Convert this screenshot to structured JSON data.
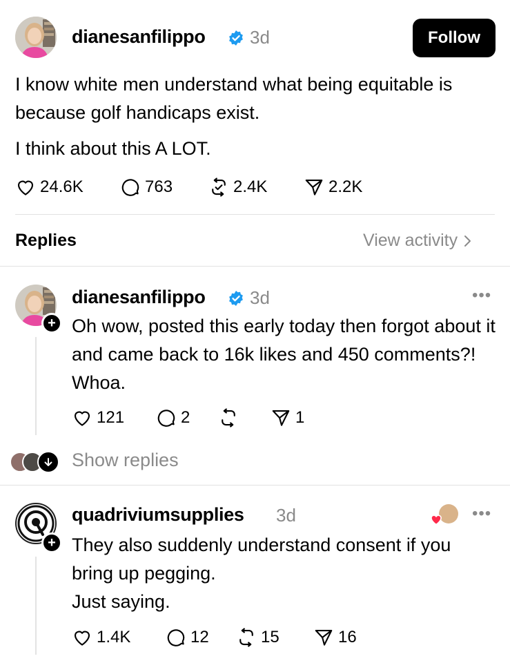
{
  "post": {
    "username": "dianesanfilippo",
    "time": "3d",
    "follow_label": "Follow",
    "paragraph1": "I know white men understand what being equitable is because golf handicaps exist.",
    "paragraph2": "I think about this A LOT.",
    "stats": {
      "likes": "24.6K",
      "comments": "763",
      "reposts": "2.4K",
      "shares": "2.2K"
    }
  },
  "replies_header": {
    "title": "Replies",
    "view_activity": "View activity"
  },
  "reply1": {
    "username": "dianesanfilippo",
    "time": "3d",
    "text": "Oh wow, posted this early today then forgot about it and came back to 16k likes and 450 comments?! Whoa.",
    "stats": {
      "likes": "121",
      "comments": "2",
      "shares": "1"
    },
    "show_replies": "Show replies"
  },
  "reply2": {
    "username": "quadriviumsupplies",
    "time": "3d",
    "line1": "They also suddenly understand consent if you bring up pegging.",
    "line2": "Just saying.",
    "stats": {
      "likes": "1.4K",
      "comments": "12",
      "reposts": "15",
      "shares": "16"
    }
  },
  "colors": {
    "verified": "#1d9bf0",
    "secondary_text": "#8a8a8a",
    "divider": "#e2e2e2",
    "heart": "#ff2a4a"
  },
  "icons": [
    "verified-badge-icon",
    "heart-icon",
    "comment-icon",
    "repost-icon",
    "share-icon",
    "chevron-right-icon",
    "more-icon",
    "plus-icon",
    "arrow-down-icon"
  ]
}
